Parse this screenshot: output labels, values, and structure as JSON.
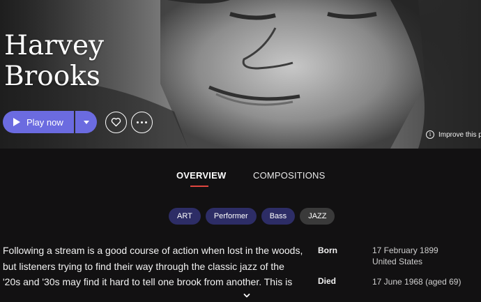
{
  "artist": {
    "name": "Harvey Brooks"
  },
  "actions": {
    "play_label": "Play now",
    "play_icon": "play-icon",
    "dropdown_icon": "chevron-down-icon",
    "favorite_icon": "heart-icon",
    "more_icon": "more-dots-icon",
    "improve_label": "Improve this p",
    "improve_icon": "info-icon"
  },
  "tabs": [
    {
      "label": "OVERVIEW",
      "active": true
    },
    {
      "label": "COMPOSITIONS",
      "active": false
    }
  ],
  "tags": [
    {
      "label": "ART",
      "kind": "role"
    },
    {
      "label": "Performer",
      "kind": "role"
    },
    {
      "label": "Bass",
      "kind": "role"
    },
    {
      "label": "JAZZ",
      "kind": "genre"
    }
  ],
  "bio": {
    "lines": [
      "Following a stream is a good course of action when lost in the woods,",
      "but listeners trying to find their way through the classic jazz of the",
      "'20s and '30s may find it hard to tell one brook from another. This is"
    ]
  },
  "facts": {
    "born": {
      "label": "Born",
      "date": "17 February 1899",
      "place": "United States"
    },
    "died": {
      "label": "Died",
      "date": "17 June 1968 (aged 69)"
    }
  },
  "expand_icon": "chevron-down-icon",
  "colors": {
    "accent": "#6b6be0",
    "tab_underline": "#e0463f",
    "tag_role_bg": "#2d2d66",
    "tag_genre_bg": "#3a3a3a",
    "background": "#121112"
  }
}
